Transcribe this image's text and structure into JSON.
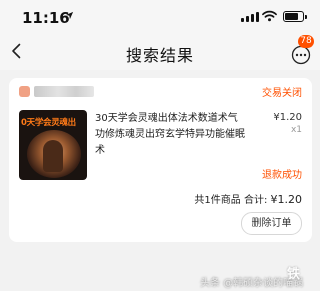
{
  "status_bar": {
    "time": "11:16",
    "location_icon": "location-arrow-icon",
    "signal_icon": "cellular-signal-icon",
    "wifi_icon": "wifi-icon",
    "battery_icon": "battery-icon",
    "battery_level": 0.8
  },
  "nav": {
    "back_icon": "chevron-left-icon",
    "title": "搜索结果",
    "more_icon": "more-icon",
    "badge": "78"
  },
  "order": {
    "status": "交易关闭",
    "product": {
      "thumbnail_caption": "0天学会灵魂出",
      "title": "30天学会灵魂出体法术数道术气功修炼魂灵出窍玄学特异功能催眠术",
      "price": "¥1.20",
      "quantity": "x1"
    },
    "refund_status": "退款成功",
    "total_text": "共1件商品 合计: ",
    "total_amount": "¥1.20",
    "delete_button_label": "删除订单"
  },
  "watermark": {
    "text": "头条 @韩硕杂谈的喵锅",
    "logo": "铁"
  },
  "colors": {
    "accent": "#ff5000",
    "background": "#f2f2f2",
    "card": "#ffffff"
  }
}
